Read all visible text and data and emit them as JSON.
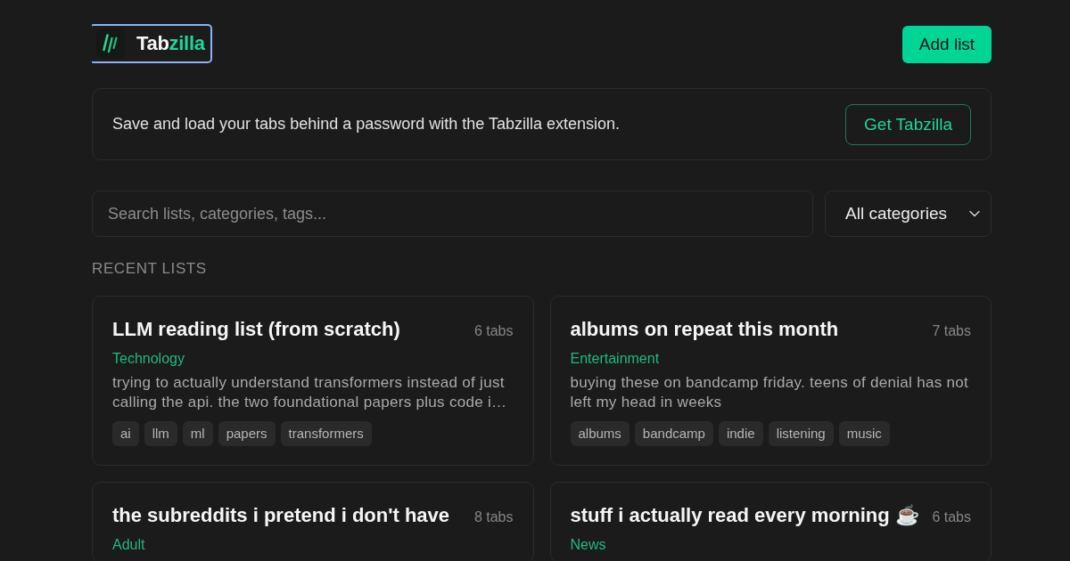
{
  "header": {
    "logo": {
      "focused": true,
      "wordmark": [
        {
          "text": "Tab",
          "accent": false
        },
        {
          "text": "zilla",
          "accent": true
        }
      ]
    },
    "add_button": "Add list"
  },
  "banner": {
    "text": "Save and load your tabs behind a password with the Tabzilla extension.",
    "button": "Get Tabzilla"
  },
  "filters": {
    "search": {
      "placeholder": "Search lists, categories, tags..."
    },
    "category_select": {
      "value": "All categories"
    }
  },
  "section_title": "RECENT LISTS",
  "lists": [
    {
      "title": "LLM reading list (from scratch)",
      "tab_count": "6 tabs",
      "category": "Technology",
      "description": "trying to actually understand transformers instead of just calling the api. the two foundational papers plus code i…",
      "tags": [
        "ai",
        "llm",
        "ml",
        "papers",
        "transformers"
      ]
    },
    {
      "title": "albums on repeat this month",
      "tab_count": "7 tabs",
      "category": "Entertainment",
      "description": "buying these on bandcamp friday. teens of denial has not left my head in weeks",
      "tags": [
        "albums",
        "bandcamp",
        "indie",
        "listening",
        "music"
      ]
    },
    {
      "title": "the subreddits i pretend i don't have",
      "tab_count": "8 tabs",
      "category": "Adult"
    },
    {
      "title": "stuff i actually read every morning ☕",
      "tab_count": "6 tabs",
      "category": "News"
    }
  ]
}
